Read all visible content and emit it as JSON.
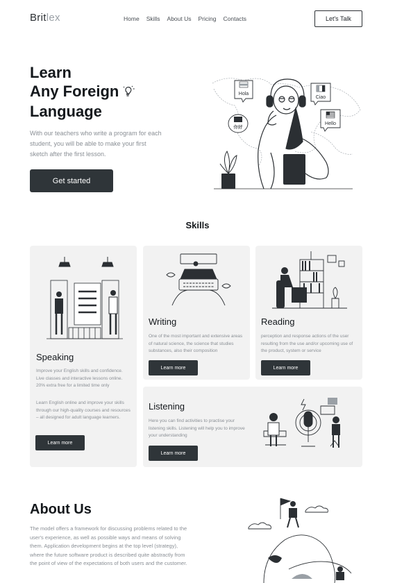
{
  "brand": {
    "logo_main": "Brit",
    "logo_soft": "lex"
  },
  "nav": {
    "items": [
      "Home",
      "Skills",
      "About Us",
      "Pricing",
      "Contacts"
    ],
    "cta": "Let's Talk"
  },
  "hero": {
    "title_line1": "Learn",
    "title_line2": "Any Foreign",
    "title_line3": "Language",
    "description": "With our teachers who write a program for each student, you will be able to make your first sketch after the first lesson.",
    "button": "Get started",
    "bubbles": [
      "Hola",
      "Ciao",
      "Hello",
      "你好"
    ]
  },
  "skills": {
    "title": "Skills",
    "cards": [
      {
        "title": "Speaking",
        "text1": "Improve your English skills and confidence. Live classes and interactive lessons online. 20% extra free for a limited time only",
        "text2": "Learn English online and improve your skills through our high-quality courses and resources – all designed for adult language learners.",
        "button": "Learn more"
      },
      {
        "title": "Writing",
        "text1": "One of the most important and extensive areas of natural science, the science that studies substances, also their composition",
        "button": "Learn more"
      },
      {
        "title": "Reading",
        "text1": "perception and response actions of the user resulting from the use and/or upcoming use of the product, system or service",
        "button": "Learn more"
      },
      {
        "title": "Listening",
        "text1": "Here you can find activities to practise your listening skills. Listening will help you to improve your understanding",
        "button": "Learn more"
      }
    ]
  },
  "about": {
    "title": "About Us",
    "description": "The model offers a framework for discussing problems related to the user's experience, as well as possible ways and means of solving them. Application development begins at the top level (strategy), where the future software product is described quite abstractly from the point of view of the expectations of both users and the customer."
  },
  "colors": {
    "dark": "#2f3539",
    "card_bg": "#f2f2f2",
    "muted_text": "#8a8f95"
  }
}
